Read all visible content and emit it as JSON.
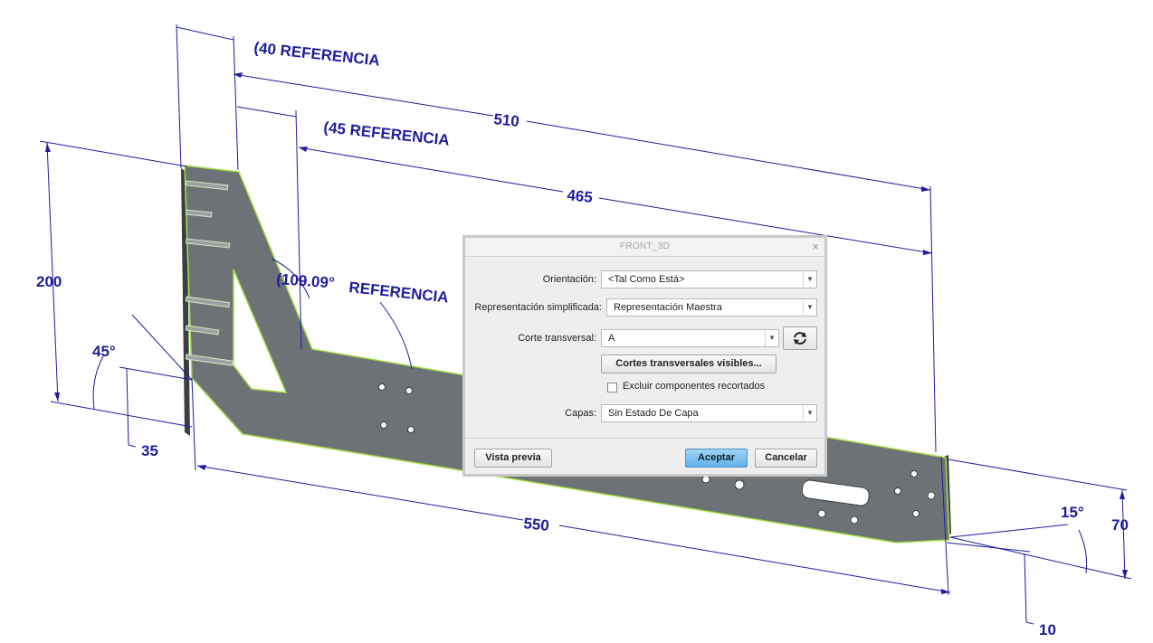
{
  "drawing": {
    "dimensions": [
      {
        "id": "d40",
        "text": "(40 REFERENCIA"
      },
      {
        "id": "d510",
        "text": "510"
      },
      {
        "id": "d45ref",
        "text": "(45 REFERENCIA"
      },
      {
        "id": "d465",
        "text": "465"
      },
      {
        "id": "d200",
        "text": "200"
      },
      {
        "id": "d10909",
        "text": "(109.09°"
      },
      {
        "id": "dref",
        "text": "REFERENCIA"
      },
      {
        "id": "d45",
        "text": "45°"
      },
      {
        "id": "d35",
        "text": "35"
      },
      {
        "id": "d550",
        "text": "550"
      },
      {
        "id": "d15",
        "text": "15°"
      },
      {
        "id": "d70",
        "text": "70"
      },
      {
        "id": "d10",
        "text": "10"
      }
    ],
    "colors": {
      "dimension": "#1d1d9e",
      "part_face": "#6d7277",
      "part_edge": "#a5e04a",
      "part_side": "#3b3f43"
    }
  },
  "dialog": {
    "title": "FRONT_3D",
    "orientation_label": "Orientación:",
    "orientation_value": "<Tal Como Está>",
    "simplified_label": "Representación simplificada:",
    "simplified_value": "Representación Maestra",
    "cross_section_label": "Corte transversal:",
    "cross_section_value": "A",
    "visible_sections_button": "Cortes transversales visibles...",
    "exclude_label": "Excluir componentes recortados",
    "exclude_checked": false,
    "layers_label": "Capas:",
    "layers_value": "Sin Estado De Capa",
    "preview_button": "Vista previa",
    "accept_button": "Aceptar",
    "cancel_button": "Cancelar",
    "accent_color": "#5eb2ea"
  }
}
